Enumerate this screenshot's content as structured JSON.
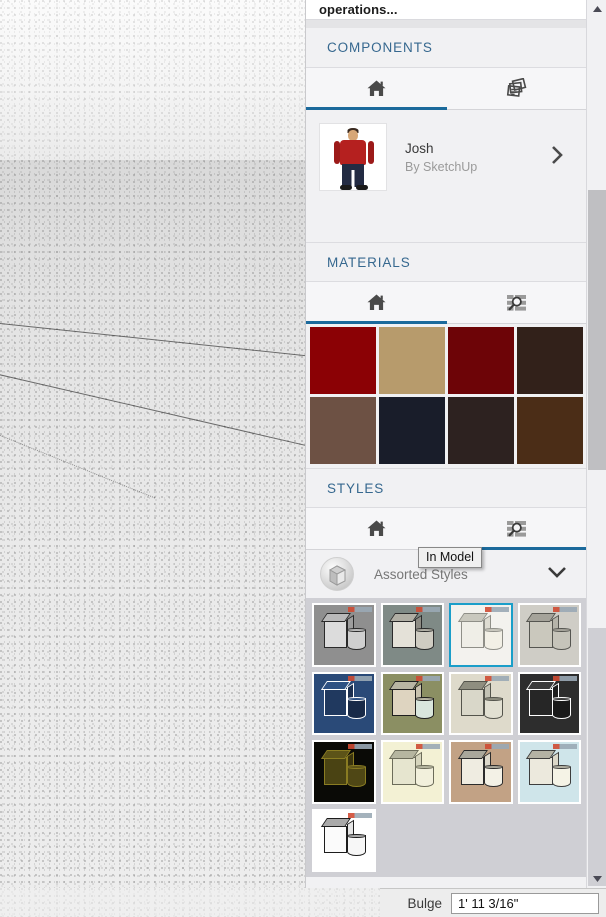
{
  "window": {
    "caption": "operations...",
    "viewport_name": "3d-viewport"
  },
  "tray": {
    "sections": [
      {
        "id": "components",
        "title": "COMPONENTS",
        "tabs": [
          {
            "id": "home",
            "icon": "home-icon",
            "active": true
          },
          {
            "id": "warehouse",
            "icon": "3d-warehouse-icon",
            "active": false
          }
        ],
        "items": [
          {
            "name": "Josh",
            "author": "By SketchUp",
            "thumb": "person-thumbnail",
            "chevron": "chevron-right-icon"
          }
        ]
      },
      {
        "id": "materials",
        "title": "MATERIALS",
        "tabs": [
          {
            "id": "home",
            "icon": "home-icon",
            "active": true
          },
          {
            "id": "browse",
            "icon": "browse-search-icon",
            "active": false
          }
        ],
        "swatches": [
          {
            "name": "swatch-dark-red",
            "color": "#8b0105"
          },
          {
            "name": "swatch-tan",
            "color": "#b79b6c"
          },
          {
            "name": "swatch-maroon",
            "color": "#6d0407"
          },
          {
            "name": "swatch-dark-brown",
            "color": "#32211a"
          },
          {
            "name": "swatch-medium-brown",
            "color": "#6d5144"
          },
          {
            "name": "swatch-navy-black",
            "color": "#191d2a"
          },
          {
            "name": "swatch-charcoal",
            "color": "#2d2220"
          },
          {
            "name": "swatch-chestnut",
            "color": "#4b2d17"
          }
        ]
      },
      {
        "id": "styles",
        "title": "STYLES",
        "tabs": [
          {
            "id": "home",
            "icon": "home-icon",
            "active": false
          },
          {
            "id": "browse",
            "icon": "browse-search-icon",
            "active": true
          }
        ],
        "collection": {
          "label": "Assorted Styles",
          "thumb": "style-collection-icon",
          "chevron": "chevron-down-icon"
        },
        "thumbnails": [
          {
            "name": "style-sketchy-grey",
            "bg": "#8f8f8f",
            "box": "#dcdcdc",
            "top": "#b9b9b9",
            "side": "#9d9d9d",
            "cyl": "#cfcfcf",
            "edge": "#2a2a2a",
            "selected": false,
            "badge": true
          },
          {
            "name": "style-slate-shaded",
            "bg": "#7f8a86",
            "box": "#e4e1d8",
            "top": "#b0aea4",
            "side": "#8e8c84",
            "cyl": "#cfccc2",
            "edge": "#2b2b2b",
            "selected": false,
            "badge": true
          },
          {
            "name": "style-simple-white",
            "bg": "#f3f2ee",
            "box": "#efeee7",
            "top": "#c9c8be",
            "side": "#dedcd2",
            "cyl": "#f2f0e6",
            "edge": "#8f8f88",
            "selected": true,
            "badge": true
          },
          {
            "name": "style-soft-grey",
            "bg": "#cfcdc6",
            "box": "#cac8bd",
            "top": "#a5a39a",
            "side": "#b6b4aa",
            "cyl": "#c6c4ba",
            "edge": "#555550",
            "selected": false,
            "badge": true
          },
          {
            "name": "style-blueprint",
            "bg": "#2a4a78",
            "box": "#20395f",
            "top": "#2e5183",
            "side": "#1b2f50",
            "cyl": "#182a48",
            "edge": "#ffffff",
            "selected": false,
            "badge": true
          },
          {
            "name": "style-sketch-green",
            "bg": "#8b8f63",
            "box": "#ded4c0",
            "top": "#b8b5a3",
            "side": "#c9c2ae",
            "cyl": "#d9e6dd",
            "edge": "#1e1e1e",
            "selected": false,
            "badge": true
          },
          {
            "name": "style-parchment",
            "bg": "#dedacb",
            "box": "#d9d7c9",
            "top": "#8f8e80",
            "side": "#c3c2b4",
            "cyl": "#e2e0d2",
            "edge": "#54544c",
            "selected": false,
            "badge": true
          },
          {
            "name": "style-dark-axes",
            "bg": "#2d2d2d",
            "box": "#262626",
            "top": "#3a3a3a",
            "side": "#1d1d1d",
            "cyl": "#1a1a1a",
            "edge": "#ffffff",
            "selected": false,
            "badge": true
          },
          {
            "name": "style-olive-on-black",
            "bg": "#0a0a06",
            "box": "#4a4313",
            "top": "#5c5318",
            "side": "#3a340f",
            "cyl": "#4f4715",
            "edge": "#8a7c22",
            "selected": false,
            "badge": true
          },
          {
            "name": "style-pale-yellow",
            "bg": "#f3f1d4",
            "box": "#e6e5cf",
            "top": "#b6b6a0",
            "side": "#d6d5bd",
            "cyl": "#f2f0dc",
            "edge": "#6c6c5a",
            "selected": false,
            "badge": true
          },
          {
            "name": "style-kraft-paper",
            "bg": "#c2a285",
            "box": "#efece1",
            "top": "#a9a79b",
            "side": "#ddd9cc",
            "cyl": "#f3f1e6",
            "edge": "#2b2b2b",
            "selected": false,
            "badge": true
          },
          {
            "name": "style-watercolor-sky",
            "bg": "#cfe5ea",
            "box": "#ece9dd",
            "top": "#b4b2a4",
            "side": "#dcd8c9",
            "cyl": "#f5f3e6",
            "edge": "#3d3d3d",
            "selected": false,
            "badge": true
          },
          {
            "name": "style-plain-white",
            "bg": "#ffffff",
            "box": "#fbfbfb",
            "top": "#a9a9a9",
            "side": "#e6e6e6",
            "cyl": "#f7f7f7",
            "edge": "#1d1d1d",
            "selected": false,
            "badge": true
          }
        ],
        "tooltip": "In Model"
      }
    ]
  },
  "scrollbar": {
    "up_arrow": "scroll-up-arrow-icon",
    "down_arrow": "scroll-down-arrow-icon"
  },
  "statusbar": {
    "vcb_label": "Bulge",
    "vcb_value": "1' 11 3/16\""
  },
  "colors": {
    "accent_blue": "#1b6a9c",
    "section_title": "#36688f",
    "selection_cyan": "#1a9ec9",
    "tray_bg": "#f1f1f3"
  }
}
